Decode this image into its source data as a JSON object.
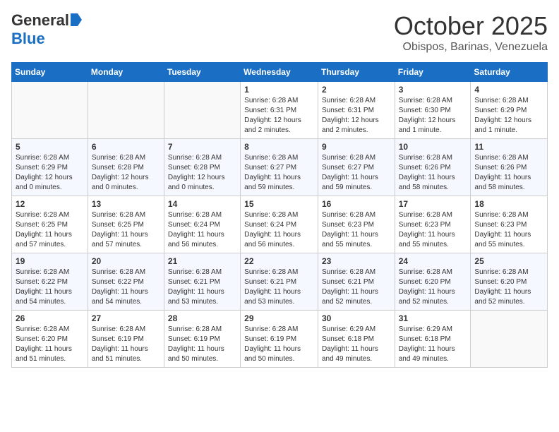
{
  "header": {
    "logo_general": "General",
    "logo_blue": "Blue",
    "month_title": "October 2025",
    "location": "Obispos, Barinas, Venezuela"
  },
  "weekdays": [
    "Sunday",
    "Monday",
    "Tuesday",
    "Wednesday",
    "Thursday",
    "Friday",
    "Saturday"
  ],
  "weeks": [
    [
      {
        "day": "",
        "sunrise": "",
        "sunset": "",
        "daylight": ""
      },
      {
        "day": "",
        "sunrise": "",
        "sunset": "",
        "daylight": ""
      },
      {
        "day": "",
        "sunrise": "",
        "sunset": "",
        "daylight": ""
      },
      {
        "day": "1",
        "sunrise": "Sunrise: 6:28 AM",
        "sunset": "Sunset: 6:31 PM",
        "daylight": "Daylight: 12 hours and 2 minutes."
      },
      {
        "day": "2",
        "sunrise": "Sunrise: 6:28 AM",
        "sunset": "Sunset: 6:31 PM",
        "daylight": "Daylight: 12 hours and 2 minutes."
      },
      {
        "day": "3",
        "sunrise": "Sunrise: 6:28 AM",
        "sunset": "Sunset: 6:30 PM",
        "daylight": "Daylight: 12 hours and 1 minute."
      },
      {
        "day": "4",
        "sunrise": "Sunrise: 6:28 AM",
        "sunset": "Sunset: 6:29 PM",
        "daylight": "Daylight: 12 hours and 1 minute."
      }
    ],
    [
      {
        "day": "5",
        "sunrise": "Sunrise: 6:28 AM",
        "sunset": "Sunset: 6:29 PM",
        "daylight": "Daylight: 12 hours and 0 minutes."
      },
      {
        "day": "6",
        "sunrise": "Sunrise: 6:28 AM",
        "sunset": "Sunset: 6:28 PM",
        "daylight": "Daylight: 12 hours and 0 minutes."
      },
      {
        "day": "7",
        "sunrise": "Sunrise: 6:28 AM",
        "sunset": "Sunset: 6:28 PM",
        "daylight": "Daylight: 12 hours and 0 minutes."
      },
      {
        "day": "8",
        "sunrise": "Sunrise: 6:28 AM",
        "sunset": "Sunset: 6:27 PM",
        "daylight": "Daylight: 11 hours and 59 minutes."
      },
      {
        "day": "9",
        "sunrise": "Sunrise: 6:28 AM",
        "sunset": "Sunset: 6:27 PM",
        "daylight": "Daylight: 11 hours and 59 minutes."
      },
      {
        "day": "10",
        "sunrise": "Sunrise: 6:28 AM",
        "sunset": "Sunset: 6:26 PM",
        "daylight": "Daylight: 11 hours and 58 minutes."
      },
      {
        "day": "11",
        "sunrise": "Sunrise: 6:28 AM",
        "sunset": "Sunset: 6:26 PM",
        "daylight": "Daylight: 11 hours and 58 minutes."
      }
    ],
    [
      {
        "day": "12",
        "sunrise": "Sunrise: 6:28 AM",
        "sunset": "Sunset: 6:25 PM",
        "daylight": "Daylight: 11 hours and 57 minutes."
      },
      {
        "day": "13",
        "sunrise": "Sunrise: 6:28 AM",
        "sunset": "Sunset: 6:25 PM",
        "daylight": "Daylight: 11 hours and 57 minutes."
      },
      {
        "day": "14",
        "sunrise": "Sunrise: 6:28 AM",
        "sunset": "Sunset: 6:24 PM",
        "daylight": "Daylight: 11 hours and 56 minutes."
      },
      {
        "day": "15",
        "sunrise": "Sunrise: 6:28 AM",
        "sunset": "Sunset: 6:24 PM",
        "daylight": "Daylight: 11 hours and 56 minutes."
      },
      {
        "day": "16",
        "sunrise": "Sunrise: 6:28 AM",
        "sunset": "Sunset: 6:23 PM",
        "daylight": "Daylight: 11 hours and 55 minutes."
      },
      {
        "day": "17",
        "sunrise": "Sunrise: 6:28 AM",
        "sunset": "Sunset: 6:23 PM",
        "daylight": "Daylight: 11 hours and 55 minutes."
      },
      {
        "day": "18",
        "sunrise": "Sunrise: 6:28 AM",
        "sunset": "Sunset: 6:23 PM",
        "daylight": "Daylight: 11 hours and 55 minutes."
      }
    ],
    [
      {
        "day": "19",
        "sunrise": "Sunrise: 6:28 AM",
        "sunset": "Sunset: 6:22 PM",
        "daylight": "Daylight: 11 hours and 54 minutes."
      },
      {
        "day": "20",
        "sunrise": "Sunrise: 6:28 AM",
        "sunset": "Sunset: 6:22 PM",
        "daylight": "Daylight: 11 hours and 54 minutes."
      },
      {
        "day": "21",
        "sunrise": "Sunrise: 6:28 AM",
        "sunset": "Sunset: 6:21 PM",
        "daylight": "Daylight: 11 hours and 53 minutes."
      },
      {
        "day": "22",
        "sunrise": "Sunrise: 6:28 AM",
        "sunset": "Sunset: 6:21 PM",
        "daylight": "Daylight: 11 hours and 53 minutes."
      },
      {
        "day": "23",
        "sunrise": "Sunrise: 6:28 AM",
        "sunset": "Sunset: 6:21 PM",
        "daylight": "Daylight: 11 hours and 52 minutes."
      },
      {
        "day": "24",
        "sunrise": "Sunrise: 6:28 AM",
        "sunset": "Sunset: 6:20 PM",
        "daylight": "Daylight: 11 hours and 52 minutes."
      },
      {
        "day": "25",
        "sunrise": "Sunrise: 6:28 AM",
        "sunset": "Sunset: 6:20 PM",
        "daylight": "Daylight: 11 hours and 52 minutes."
      }
    ],
    [
      {
        "day": "26",
        "sunrise": "Sunrise: 6:28 AM",
        "sunset": "Sunset: 6:20 PM",
        "daylight": "Daylight: 11 hours and 51 minutes."
      },
      {
        "day": "27",
        "sunrise": "Sunrise: 6:28 AM",
        "sunset": "Sunset: 6:19 PM",
        "daylight": "Daylight: 11 hours and 51 minutes."
      },
      {
        "day": "28",
        "sunrise": "Sunrise: 6:28 AM",
        "sunset": "Sunset: 6:19 PM",
        "daylight": "Daylight: 11 hours and 50 minutes."
      },
      {
        "day": "29",
        "sunrise": "Sunrise: 6:28 AM",
        "sunset": "Sunset: 6:19 PM",
        "daylight": "Daylight: 11 hours and 50 minutes."
      },
      {
        "day": "30",
        "sunrise": "Sunrise: 6:29 AM",
        "sunset": "Sunset: 6:18 PM",
        "daylight": "Daylight: 11 hours and 49 minutes."
      },
      {
        "day": "31",
        "sunrise": "Sunrise: 6:29 AM",
        "sunset": "Sunset: 6:18 PM",
        "daylight": "Daylight: 11 hours and 49 minutes."
      },
      {
        "day": "",
        "sunrise": "",
        "sunset": "",
        "daylight": ""
      }
    ]
  ]
}
